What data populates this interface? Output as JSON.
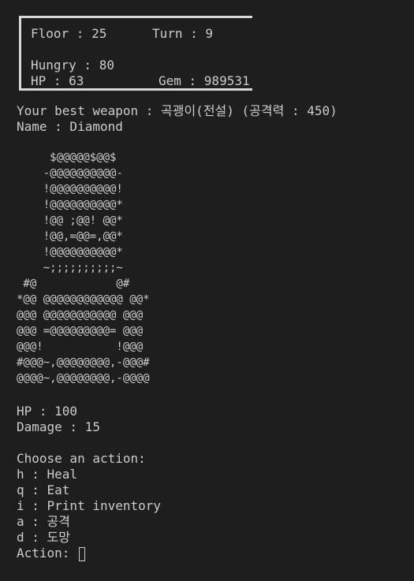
{
  "status": {
    "floor": "Floor : 25",
    "turn": "Turn : 9",
    "hungry": "Hungry : 80",
    "hp": "HP : 63",
    "gem": "Gem : 989531"
  },
  "weapon_line": "Your best weapon : 곡괭이(전설) (공격력 : 450)",
  "name_line": "Name : Diamond",
  "monster_art": "     $@@@@@$@@$\n    -@@@@@@@@@@-\n    !@@@@@@@@@@!\n    !@@@@@@@@@@*\n    !@@ ;@@! @@*\n    !@@,=@@=,@@*\n    !@@@@@@@@@@*\n    ~;;;;;;;;;;~\n #@            @#\n*@@ @@@@@@@@@@@@ @@*\n@@@ @@@@@@@@@@@ @@@\n@@@ =@@@@@@@@@= @@@\n@@@!           !@@@\n#@@@~,@@@@@@@@,-@@@#\n@@@@~,@@@@@@@@,-@@@@",
  "monster": {
    "hp": "HP : 100",
    "damage": "Damage : 15"
  },
  "menu": {
    "title": "Choose an action:",
    "options": [
      "h : Heal",
      "q : Eat",
      "i : Print inventory",
      "a : 공격",
      "d : 도망"
    ]
  },
  "prompt": "Action: "
}
